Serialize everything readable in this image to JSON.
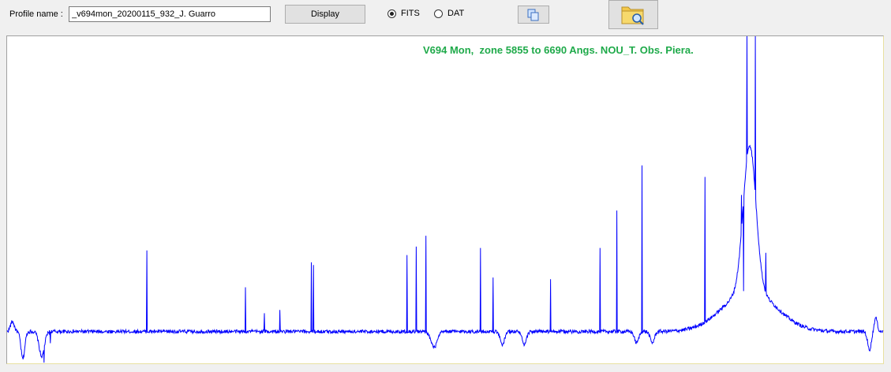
{
  "profile": {
    "label": "Profile name :",
    "value": "_v694mon_20200115_932_J. Guarro"
  },
  "buttons": {
    "display_label": "Display"
  },
  "radio": {
    "fits_label": "FITS",
    "dat_label": "DAT",
    "selected": "FITS"
  },
  "icons": {
    "copy": "copy-icon",
    "folder": "folder-search-icon"
  },
  "colors": {
    "series": "#0000ff",
    "title": "#1faa4a"
  },
  "chart_data": {
    "type": "line",
    "title": "V694 Mon,  zone 5855 to 6690 Angs. NOU_T. Obs. Piera.",
    "xlabel": "",
    "ylabel": "",
    "xlim": [
      5855,
      6690
    ],
    "ylim": [
      0.3,
      7.5
    ],
    "grid": false,
    "axes_visible": false,
    "continuum": 1.0,
    "noise": 0.04,
    "features": [
      {
        "x": 5860,
        "kind": "broad",
        "amp": 0.22,
        "width": 1.8
      },
      {
        "x": 5870,
        "kind": "broad",
        "amp": -0.6,
        "width": 1.8
      },
      {
        "x": 5888,
        "kind": "broad",
        "amp": -0.55,
        "width": 2.5
      },
      {
        "x": 5890,
        "kind": "spike",
        "amp": -0.3
      },
      {
        "x": 5896,
        "kind": "spike",
        "amp": -0.25
      },
      {
        "x": 5988,
        "kind": "spike",
        "amp": 1.8
      },
      {
        "x": 6082,
        "kind": "spike",
        "amp": 1.0
      },
      {
        "x": 6100,
        "kind": "spike",
        "amp": 0.4
      },
      {
        "x": 6115,
        "kind": "spike",
        "amp": 0.45
      },
      {
        "x": 6145,
        "kind": "spike",
        "amp": 1.5
      },
      {
        "x": 6147,
        "kind": "spike",
        "amp": 1.45
      },
      {
        "x": 6236,
        "kind": "spike",
        "amp": 1.7
      },
      {
        "x": 6245,
        "kind": "spike",
        "amp": 1.9
      },
      {
        "x": 6254,
        "kind": "spike",
        "amp": 2.15
      },
      {
        "x": 6262,
        "kind": "broad",
        "amp": -0.35,
        "width": 3.0
      },
      {
        "x": 6306,
        "kind": "spike",
        "amp": 1.85
      },
      {
        "x": 6318,
        "kind": "spike",
        "amp": 1.2
      },
      {
        "x": 6327,
        "kind": "broad",
        "amp": -0.3,
        "width": 2.0
      },
      {
        "x": 6348,
        "kind": "broad",
        "amp": -0.3,
        "width": 2.0
      },
      {
        "x": 6373,
        "kind": "spike",
        "amp": 1.15
      },
      {
        "x": 6420,
        "kind": "spike",
        "amp": 1.8
      },
      {
        "x": 6436,
        "kind": "spike",
        "amp": 2.7
      },
      {
        "x": 6455,
        "kind": "broad",
        "amp": -0.25,
        "width": 2.0
      },
      {
        "x": 6460,
        "kind": "spike",
        "amp": 3.7
      },
      {
        "x": 6470,
        "kind": "broad",
        "amp": -0.25,
        "width": 2.0
      },
      {
        "x": 6520,
        "kind": "spike",
        "amp": 3.2
      },
      {
        "x": 6562.8,
        "kind": "broad",
        "amp": 3.2,
        "width": 6
      },
      {
        "x": 6562.8,
        "kind": "broad",
        "amp": 0.9,
        "width": 25
      },
      {
        "x": 6555,
        "kind": "spike",
        "amp": 0.8
      },
      {
        "x": 6557,
        "kind": "spike",
        "amp": -2.0
      },
      {
        "x": 6560,
        "kind": "spike",
        "amp": 7.0
      },
      {
        "x": 6568,
        "kind": "spike",
        "amp": 7.0
      },
      {
        "x": 6578,
        "kind": "spike",
        "amp": 0.9
      },
      {
        "x": 6677,
        "kind": "broad",
        "amp": -0.4,
        "width": 1.8
      },
      {
        "x": 6683,
        "kind": "broad",
        "amp": 0.3,
        "width": 1.5
      }
    ]
  }
}
